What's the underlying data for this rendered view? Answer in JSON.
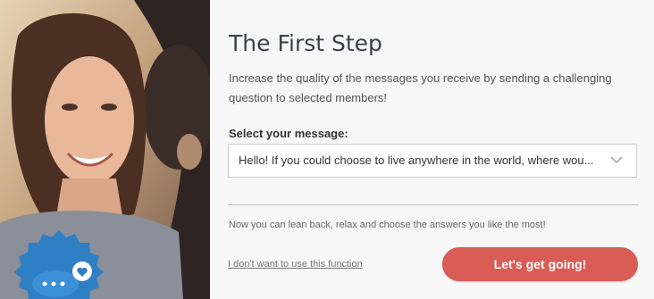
{
  "panel": {
    "title": "The First Step",
    "description": "Increase the quality of the messages you receive by sending a challenging question to selected members!",
    "select_label": "Select your message:",
    "select_value": "Hello! If you could choose to live anywhere in the world, where wou...",
    "relax_text": "Now you can lean back, relax and choose the answers you like the most!",
    "skip_link": "I don't want to use this function",
    "go_button": "Let's get going!"
  },
  "colors": {
    "accent": "#d95c55",
    "badge": "#2f7fc4",
    "panel_bg": "#f7f7f7",
    "title": "#3b3f4a"
  },
  "icons": {
    "badge": "chat-bubble-heart-icon",
    "dropdown": "chevron-down-icon"
  }
}
